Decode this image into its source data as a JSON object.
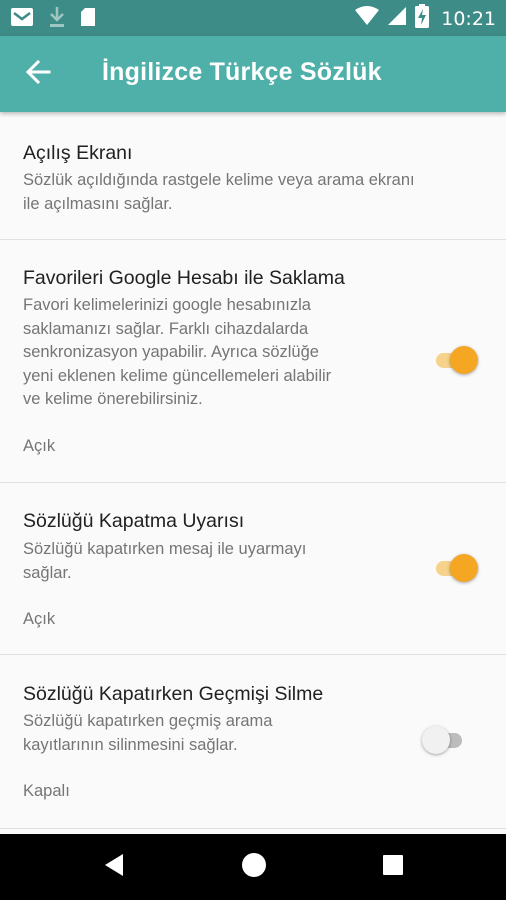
{
  "status_bar": {
    "time": "10:21",
    "icons": [
      "mail-icon",
      "download-icon",
      "sd-card-icon",
      "wifi-icon",
      "signal-icon",
      "battery-charging-icon"
    ]
  },
  "app_bar": {
    "title": "İngilizce Türkçe Sözlük",
    "back_icon": "arrow-back-icon"
  },
  "colors": {
    "status_bar": "#3e8c87",
    "app_bar": "#4fb0aa",
    "switch_on": "#f5a623",
    "background": "#fafafa"
  },
  "preferences": [
    {
      "title": "Açılış Ekranı",
      "summary": [
        "Sözlük açıldığında rastgele kelime veya arama ekranı",
        "ile açılmasını sağlar."
      ]
    },
    {
      "title": "Favorileri Google Hesabı ile Saklama",
      "summary": [
        "Favori kelimelerinizi google hesabınızla",
        "saklamanızı sağlar. Farklı cihazdalarda",
        "senkronizasyon yapabilir. Ayrıca sözlüğe",
        "yeni eklenen kelime güncellemeleri alabilir",
        "ve kelime önerebilirsiniz."
      ],
      "state": "Açık",
      "switch_on": true
    },
    {
      "title": "Sözlüğü Kapatma Uyarısı",
      "summary": [
        "Sözlüğü kapatırken mesaj ile uyarmayı",
        "sağlar."
      ],
      "state": "Açık",
      "switch_on": true
    },
    {
      "title": "Sözlüğü Kapatırken Geçmişi Silme",
      "summary": [
        "Sözlüğü kapatırken geçmiş arama",
        "kayıtlarının silinmesini sağlar."
      ],
      "state": "Kapalı",
      "switch_on": false
    }
  ],
  "nav_bar": {
    "icons": [
      "back-triangle-icon",
      "home-circle-icon",
      "recents-square-icon"
    ]
  }
}
